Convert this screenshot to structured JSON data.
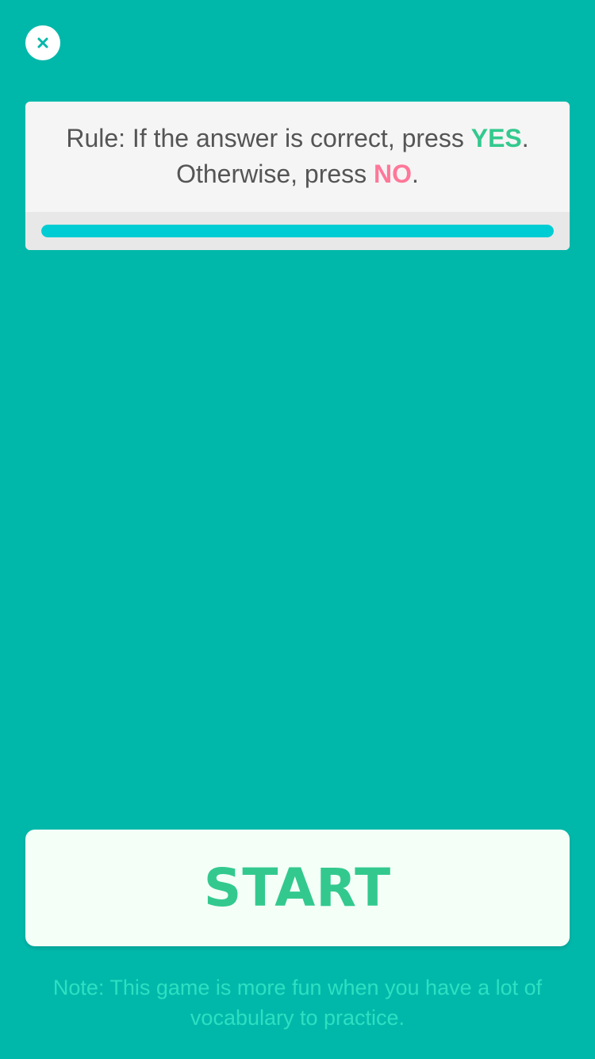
{
  "close_button": {
    "icon": "close-icon"
  },
  "rule": {
    "line1_prefix": "Rule: If the answer is correct, press ",
    "yes_keyword": "YES",
    "line1_suffix": ".",
    "line2_prefix": "Otherwise, press ",
    "no_keyword": "NO",
    "line2_suffix": "."
  },
  "progress": {
    "value": 1.0
  },
  "start_button": {
    "label": "START"
  },
  "note": {
    "text": "Note: This game is more fun when you have a lot of vocabulary to practice."
  },
  "colors": {
    "background": "#00B8AA",
    "card": "#F5F5F5",
    "yes": "#33C98E",
    "no": "#FF7799",
    "progress": "#00CDD3",
    "start_text": "#33C98E",
    "note_text": "#2DE0C2"
  }
}
